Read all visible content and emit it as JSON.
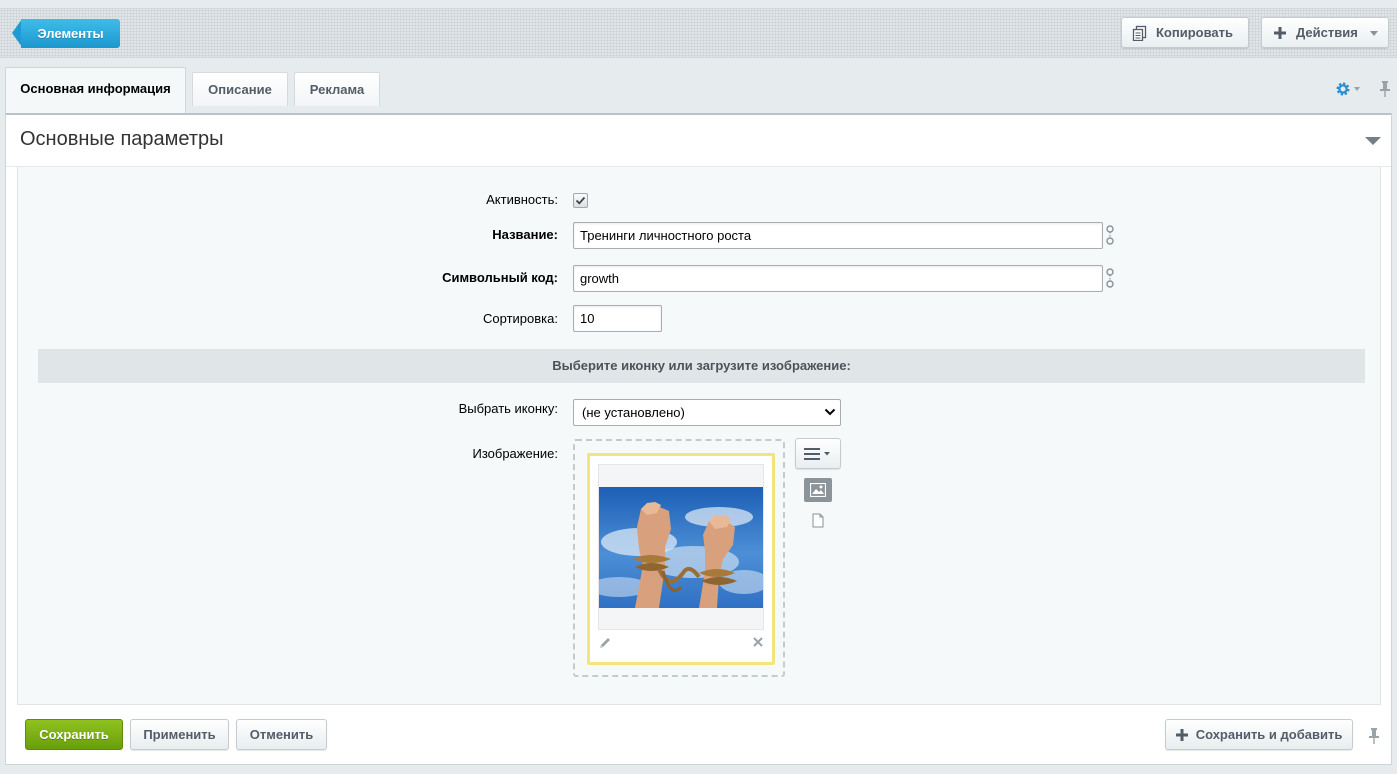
{
  "toolbar": {
    "back_label": "Элементы",
    "copy_label": "Копировать",
    "actions_label": "Действия"
  },
  "tabs": [
    {
      "label": "Основная информация",
      "active": true
    },
    {
      "label": "Описание",
      "active": false
    },
    {
      "label": "Реклама",
      "active": false
    }
  ],
  "section": {
    "title": "Основные параметры"
  },
  "form": {
    "active_label": "Активность:",
    "active_checked": true,
    "name_label": "Название:",
    "name_value": "Тренинги личностного роста",
    "code_label": "Символьный код:",
    "code_value": "growth",
    "sort_label": "Сортировка:",
    "sort_value": "10",
    "subheading": "Выберите иконку или загрузите изображение:",
    "icon_label": "Выбрать иконку:",
    "icon_value": "(не установлено)",
    "image_label": "Изображение:"
  },
  "footer": {
    "save_label": "Сохранить",
    "apply_label": "Применить",
    "cancel_label": "Отменить",
    "save_add_label": "Сохранить и добавить"
  },
  "colors": {
    "accent_blue": "#1d98cf",
    "save_green": "#6a9e0b",
    "image_border_yellow": "#f3e47c"
  },
  "icons": [
    "copy-icon",
    "plus-icon",
    "gear-icon",
    "pin-icon",
    "checkmark-icon",
    "link-icon",
    "menu-icon",
    "image-icon",
    "file-icon",
    "pencil-icon",
    "close-icon",
    "chevron-down-icon"
  ]
}
